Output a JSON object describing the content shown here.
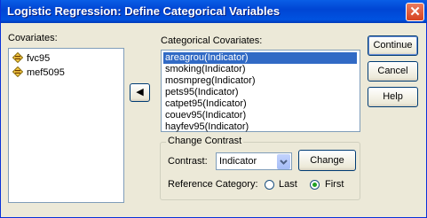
{
  "window": {
    "title": "Logistic Regression: Define Categorical Variables",
    "close_glyph": "✕"
  },
  "covariates": {
    "label": "Covariates:",
    "items": [
      {
        "label": "fvc95",
        "icon": "scale-variable-icon"
      },
      {
        "label": "mef5095",
        "icon": "scale-variable-icon"
      }
    ]
  },
  "move_button": {
    "glyph": "◀"
  },
  "categorical": {
    "label": "Categorical Covariates:",
    "items": [
      {
        "label": "areagrou(Indicator)",
        "selected": true
      },
      {
        "label": "smoking(Indicator)"
      },
      {
        "label": "mosmpreg(Indicator)"
      },
      {
        "label": "pets95(Indicator)"
      },
      {
        "label": "catpet95(Indicator)"
      },
      {
        "label": "couev95(Indicator)"
      },
      {
        "label": "hayfev95(Indicator)"
      }
    ]
  },
  "buttons": {
    "continue": "Continue",
    "cancel": "Cancel",
    "help": "Help"
  },
  "change_contrast": {
    "title": "Change Contrast",
    "contrast_label": "Contrast:",
    "contrast_value": "Indicator",
    "change_button": "Change",
    "reference_label": "Reference Category:",
    "options": [
      {
        "label": "Last",
        "checked": false
      },
      {
        "label": "First",
        "checked": true
      }
    ]
  },
  "colors": {
    "selection": "#316ac5",
    "titlebar": "#0054e3",
    "face": "#ece9d8"
  }
}
